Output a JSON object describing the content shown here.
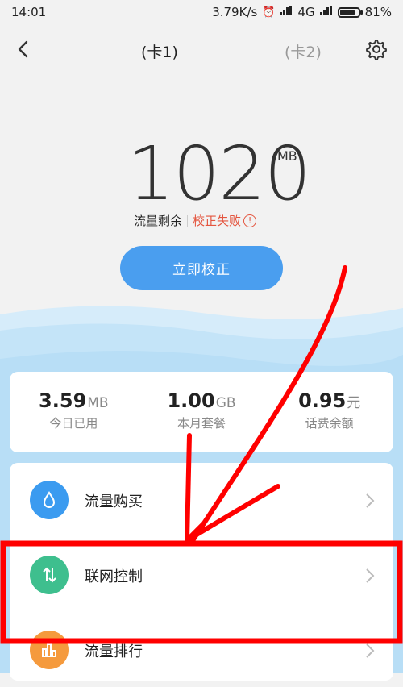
{
  "status_bar": {
    "time": "14:01",
    "speed": "3.79K/s",
    "network": "4G",
    "battery": "81%",
    "battery_level": 0.81
  },
  "header": {
    "tab1": "(卡1)",
    "tab2": "(卡2)"
  },
  "remaining": {
    "value": "1020",
    "unit": "MB",
    "label": "流量剩余",
    "fail_text": "校正失败",
    "fail_icon": "!"
  },
  "calibrate_button": "立即校正",
  "stats": [
    {
      "value": "3.59",
      "unit": "MB",
      "label": "今日已用"
    },
    {
      "value": "1.00",
      "unit": "GB",
      "label": "本月套餐"
    },
    {
      "value": "0.95",
      "unit": "元",
      "label": "话费余额"
    }
  ],
  "menu": [
    {
      "label": "流量购买",
      "icon": "droplet-icon",
      "color": "#3b9bf0"
    },
    {
      "label": "联网控制",
      "icon": "updown-arrows-icon",
      "color": "#3ebf8e"
    },
    {
      "label": "流量排行",
      "icon": "bar-chart-icon",
      "color": "#f59a3d"
    }
  ],
  "colors": {
    "accent": "#4a9eef",
    "error": "#e4553f",
    "annotation": "#ff0000"
  }
}
